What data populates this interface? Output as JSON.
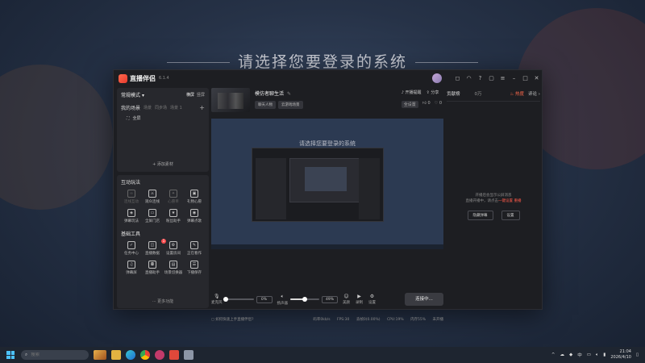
{
  "desktop": {
    "title": "请选择您要登录的系统"
  },
  "app": {
    "name": "直播伴侣",
    "version": "6.1.4",
    "left": {
      "mode_label": "常规模式",
      "orient_h": "横屏",
      "orient_v": "竖屏",
      "scene_tabs": [
        "我的场景",
        "场景",
        "同步场",
        "场景 1"
      ],
      "scene_item": "全屏",
      "add_scene": "添加素材",
      "section1": "互动玩法",
      "tools1": [
        {
          "icon": "link-icon",
          "glyph": "∞",
          "label": "连线互动",
          "dim": true
        },
        {
          "icon": "pk-icon",
          "glyph": "⚔",
          "label": "观众连线",
          "dim": false
        },
        {
          "icon": "wish-icon",
          "glyph": "✦",
          "label": "心愿单",
          "dim": true
        },
        {
          "icon": "gift-icon",
          "glyph": "▣",
          "label": "礼物心愿",
          "dim": false
        },
        {
          "icon": "game-icon",
          "glyph": "◈",
          "label": "弹幕玩法",
          "dim": false
        },
        {
          "icon": "screen-icon",
          "glyph": "▭",
          "label": "全屏门店",
          "dim": false
        },
        {
          "icon": "star-icon",
          "glyph": "★",
          "label": "粉丝助手",
          "dim": false
        },
        {
          "icon": "record-icon",
          "glyph": "◉",
          "label": "弹幕点歌",
          "dim": false
        }
      ],
      "section2": "基础工具",
      "tools2": [
        {
          "icon": "task-icon",
          "glyph": "✓",
          "label": "任务中心",
          "badge": ""
        },
        {
          "icon": "data-icon",
          "glyph": "◫",
          "label": "直播数据",
          "badge": "1"
        },
        {
          "icon": "settings-icon",
          "glyph": "⚙",
          "label": "设置房间",
          "badge": ""
        },
        {
          "icon": "edit-icon",
          "glyph": "✎",
          "label": "正在看作",
          "badge": ""
        },
        {
          "icon": "mic-tool-icon",
          "glyph": "♫",
          "label": "弹幕屏",
          "badge": ""
        },
        {
          "icon": "bag-icon",
          "glyph": "◘",
          "label": "直播助手",
          "badge": ""
        },
        {
          "icon": "file-icon",
          "glyph": "▤",
          "label": "场景切换器",
          "badge": ""
        },
        {
          "icon": "doc-icon",
          "glyph": "☰",
          "label": "下播保存",
          "badge": ""
        }
      ],
      "more": "更多功能"
    },
    "room": {
      "title": "模仿者聊生活",
      "tags": [
        "聊天人物",
        "云游戏场景"
      ],
      "broadcast_notice": "开播提醒",
      "share": "分享",
      "quality": "全设置",
      "likes": "0",
      "hearts": "0"
    },
    "preview": {
      "inner_title": "请选择您要登录的系统"
    },
    "controls": {
      "mic_label": "麦克风",
      "mic_pct": "0%",
      "mic_level": 0.05,
      "speaker_label": "扬声器",
      "speaker_pct": "49%",
      "speaker_level": 0.49,
      "beauty": "美颜",
      "record": "录制",
      "settings": "设置",
      "start": "连接中..."
    },
    "status": {
      "left": "如何快速上手直播伴侣?",
      "items": [
        "码率0kb/s",
        "FPS:30",
        "丢帧0(0.00%)",
        "CPU:19%",
        "内存55%",
        "未开播"
      ]
    },
    "right": {
      "tab1": "贡献榜",
      "tab2": "0万",
      "hot": "热度",
      "ladder": "评论",
      "notice1": "开播后会显示公屏消息",
      "notice2": "直播开播中，请点击",
      "notice_link": "一键设置",
      "notice3": "重播",
      "btn1": "隐藏弹幕",
      "btn2": "设置"
    }
  },
  "taskbar": {
    "search_placeholder": "搜索",
    "time": "21:04",
    "date": "2026/4/10",
    "ime": "中"
  }
}
